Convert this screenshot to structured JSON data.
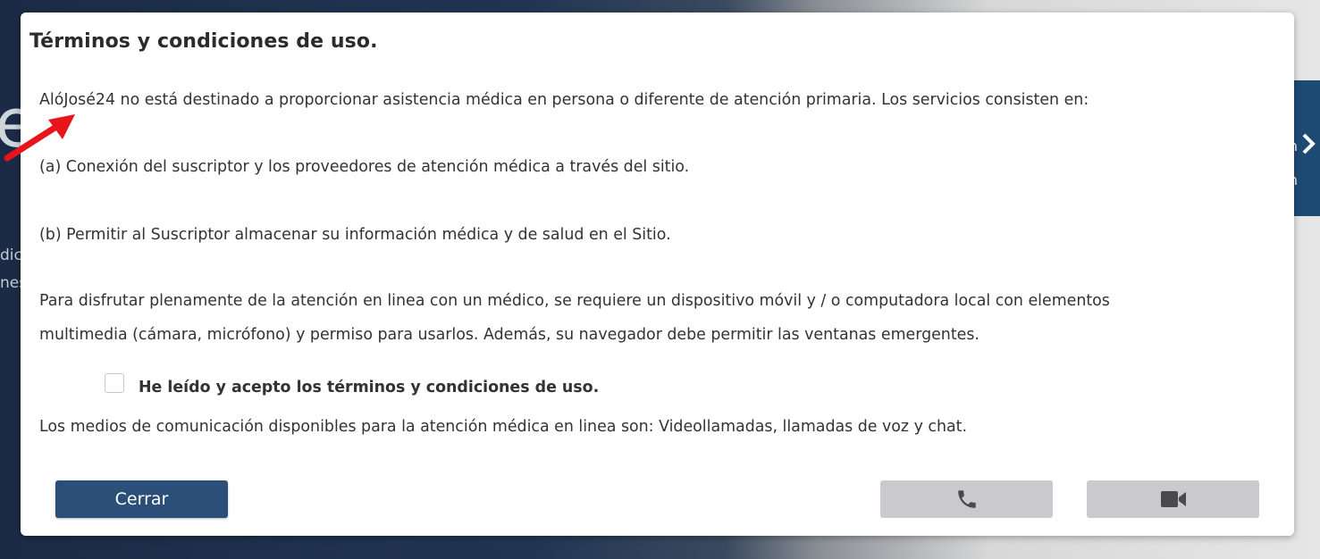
{
  "background": {
    "big_letter": "e",
    "left_fragment_1": "dic",
    "left_fragment_2": "nes",
    "right_fragment_1": "n",
    "right_fragment_2": "n"
  },
  "modal": {
    "title": "Términos y condiciones de uso.",
    "intro": "AlóJosé24 no está destinado a proporcionar asistencia médica en persona o diferente de atención primaria. Los servicios consisten en:",
    "item_a": "(a) Conexión del suscriptor y los proveedores de atención médica a través del sitio.",
    "item_b": "(b) Permitir al Suscriptor almacenar su información médica y de salud en el Sitio.",
    "requirements_line1": "Para disfrutar plenamente de la atención en linea con un médico, se requiere un dispositivo móvil y / o computadora local con elementos",
    "requirements_line2": "multimedia (cámara, micrófono) y permiso para usarlos. Además, su navegador debe permitir las ventanas emergentes.",
    "accept_label": "He leído y acepto los términos y condiciones de uso.",
    "accept_checked": false,
    "channels": "Los medios de comunicación disponibles para la atención médica en linea son: Videollamadas, llamadas de voz y chat.",
    "buttons": {
      "close_label": "Cerrar",
      "call_icon": "phone-icon",
      "video_icon": "video-camera-icon"
    }
  },
  "colors": {
    "primary_button": "#2c4f79",
    "disabled_button": "#c9c9ce",
    "annotation_arrow": "#e8141c"
  }
}
